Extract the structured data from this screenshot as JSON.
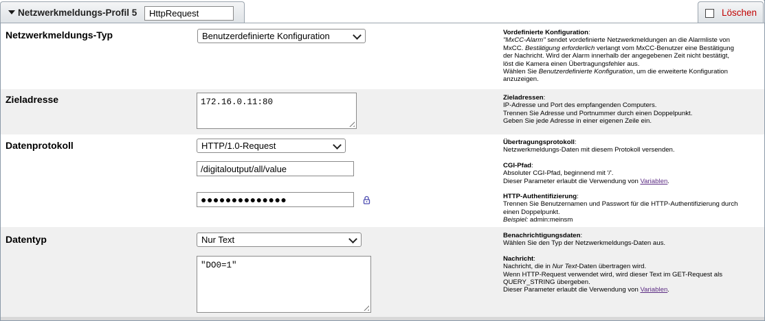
{
  "header": {
    "title": "Netzwerkmeldungs-Profil 5",
    "profile_name": "HttpRequest",
    "delete_label": "Löschen"
  },
  "rows": {
    "type": {
      "label": "Netzwerkmeldungs-Typ",
      "select_value": "Benutzerdefinierte Konfiguration",
      "help": {
        "heading": "Vordefinierte Konfiguration",
        "colon": ":",
        "l1_em": "\"MxCC-Alarm\"",
        "l1_rest": " sendet vordefinierte Netzwerkmeldungen an die Alarmliste von",
        "l2_a": "MxCC. ",
        "l2_em": "Bestätigung erforderlich",
        "l2_rest": " verlangt vom MxCC-Benutzer eine Bestätigung",
        "l3": "der Nachricht. Wird der Alarm innerhalb der angegebenen Zeit nicht bestätigt,",
        "l4": "löst die Kamera einen Übertragungsfehler aus.",
        "l5_a": "Wählen Sie ",
        "l5_em": "Benutzerdefinierte Konfiguration",
        "l5_rest": ", um die erweiterte Konfiguration",
        "l6": "anzuzeigen."
      }
    },
    "address": {
      "label": "Zieladresse",
      "value": "172.16.0.11:80",
      "help": {
        "heading": "Zieladressen",
        "colon": ":",
        "l1": "IP-Adresse und Port des empfangenden Computers.",
        "l2": "Trennen Sie Adresse und Portnummer durch einen Doppelpunkt.",
        "l3": "Geben Sie jede Adresse in einer eigenen Zeile ein."
      }
    },
    "protocol": {
      "label": "Datenprotokoll",
      "select_value": "HTTP/1.0-Request",
      "cgi_path": "/digitaloutput/all/value",
      "password_mask": "●●●●●●●●●●●●●●",
      "help": {
        "h1": "Übertragungsprotokoll",
        "colon": ":",
        "h1_l1": "Netzwerkmeldungs-Daten mit diesem Protokoll versenden.",
        "h2": "CGI-Pfad",
        "h2_l1": "Absoluter CGI-Pfad, beginnend mit '/'.",
        "h2_l2_a": "Dieser Parameter erlaubt die Verwendung von ",
        "h2_l2_link": "Variablen",
        "period": ".",
        "h3": "HTTP-Authentifizierung",
        "h3_l1": "Trennen Sie Benutzernamen und Passwort für die HTTP-Authentifizierung durch",
        "h3_l2": "einen Doppelpunkt.",
        "h3_l3_em": "Beispiel:",
        "h3_l3_rest": " admin:meinsm"
      }
    },
    "datatype": {
      "label": "Datentyp",
      "select_value": "Nur Text",
      "message": "\"DO0=1\"",
      "help": {
        "h1": "Benachrichtigungsdaten",
        "colon": ":",
        "h1_l1": "Wählen Sie den Typ der Netzwerkmeldungs-Daten aus.",
        "h2": "Nachricht",
        "h2_l1_a": "Nachricht, die in ",
        "h2_l1_em": "Nur Text",
        "h2_l1_rest": "-Daten übertragen wird.",
        "h2_l2": "Wenn HTTP-Request verwendet wird, wird dieser Text im GET-Request als",
        "h2_l3": "QUERY_STRING übergeben.",
        "h2_l4_a": "Dieser Parameter erlaubt die Verwendung von ",
        "h2_l4_link": "Variablen",
        "period": "."
      }
    }
  },
  "colors": {
    "delete": "#c00000",
    "link": "#5a2a82",
    "alt_row": "#f0f0f0",
    "lock_icon": "#4a4ab0"
  },
  "icons": [
    "chevron-down-icon",
    "checkbox-icon",
    "lock-icon",
    "resize-grip-icon"
  ]
}
